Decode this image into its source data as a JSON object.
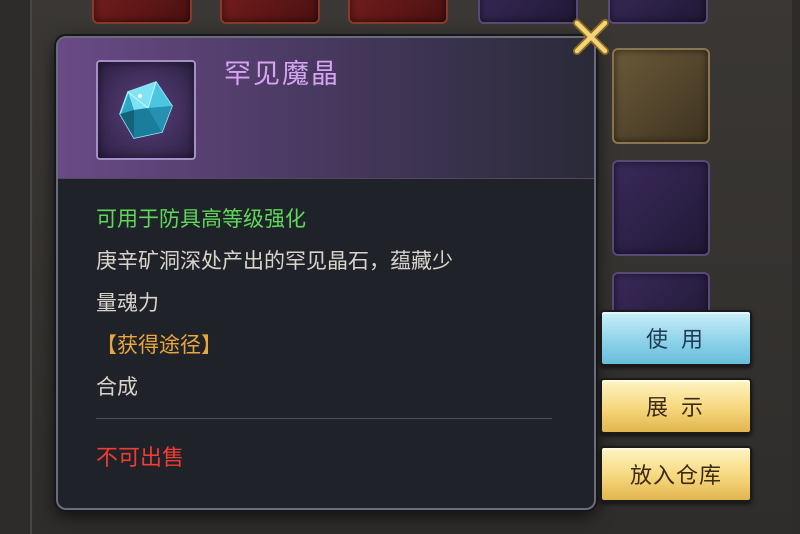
{
  "item": {
    "name": "罕见魔晶",
    "usage": "可用于防具高等级强化",
    "description_line1": "庚辛矿洞深处产出的罕见晶石，蕴藏少",
    "description_line2": "量魂力",
    "source_label": "【获得途径】",
    "source_value": "合成",
    "sale_status": "不可出售",
    "icon": "blue-crystal-icon"
  },
  "actions": {
    "use_label": "使 用",
    "show_label": "展 示",
    "store_label": "放入仓库"
  },
  "colors": {
    "item_name": "#d7a4f2",
    "usage_text": "#5fd85a",
    "source_label": "#e8a63c",
    "sale_status": "#ef3c33",
    "button_blue": "#8fd3ea",
    "button_yellow": "#f6d77d"
  }
}
